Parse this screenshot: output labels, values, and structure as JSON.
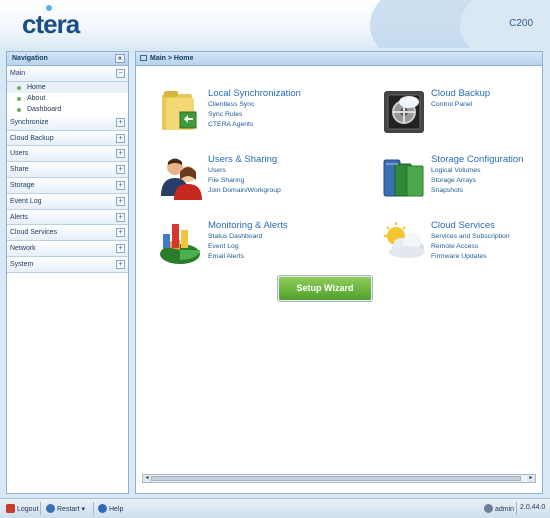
{
  "header": {
    "logo": "ctera",
    "model": "C200"
  },
  "nav": {
    "title": "Navigation",
    "collapse": "«",
    "sections": [
      {
        "label": "Main",
        "toggle": "−"
      },
      {
        "label": "Synchronize",
        "toggle": "+"
      },
      {
        "label": "Cloud Backup",
        "toggle": "+"
      },
      {
        "label": "Users",
        "toggle": "+"
      },
      {
        "label": "Share",
        "toggle": "+"
      },
      {
        "label": "Storage",
        "toggle": "+"
      },
      {
        "label": "Event Log",
        "toggle": "+"
      },
      {
        "label": "Alerts",
        "toggle": "+"
      },
      {
        "label": "Cloud Services",
        "toggle": "+"
      },
      {
        "label": "Network",
        "toggle": "+"
      },
      {
        "label": "System",
        "toggle": "+"
      }
    ],
    "main_items": [
      "Home",
      "About",
      "Dashboard"
    ]
  },
  "breadcrumb": "Main > Home",
  "features": [
    {
      "title": "Local Synchronization",
      "icon": "folder-sync-icon",
      "links": [
        "Clientless Sync",
        "Sync Rules",
        "CTERA Agents"
      ]
    },
    {
      "title": "Cloud Backup",
      "icon": "vault-icon",
      "links": [
        "Control Panel"
      ]
    },
    {
      "title": "Users & Sharing",
      "icon": "users-icon",
      "links": [
        "Users",
        "File Sharing",
        "Join Domain/Workgroup"
      ]
    },
    {
      "title": "Storage Configuration",
      "icon": "storage-icon",
      "links": [
        "Logical Volumes",
        "Storage Arrays",
        "Snapshots"
      ]
    },
    {
      "title": "Monitoring & Alerts",
      "icon": "chart-icon",
      "links": [
        "Status Dashboard",
        "Event Log",
        "Email Alerts"
      ]
    },
    {
      "title": "Cloud Services",
      "icon": "cloud-icon",
      "links": [
        "Services and Subscription",
        "Remote Access",
        "Firmware Updates"
      ]
    }
  ],
  "wizard": {
    "label": "Setup Wizard"
  },
  "footer": {
    "logout": "Logout",
    "restart": "Restart",
    "help": "Help",
    "user": "admin",
    "version": "2.0.44.0"
  }
}
